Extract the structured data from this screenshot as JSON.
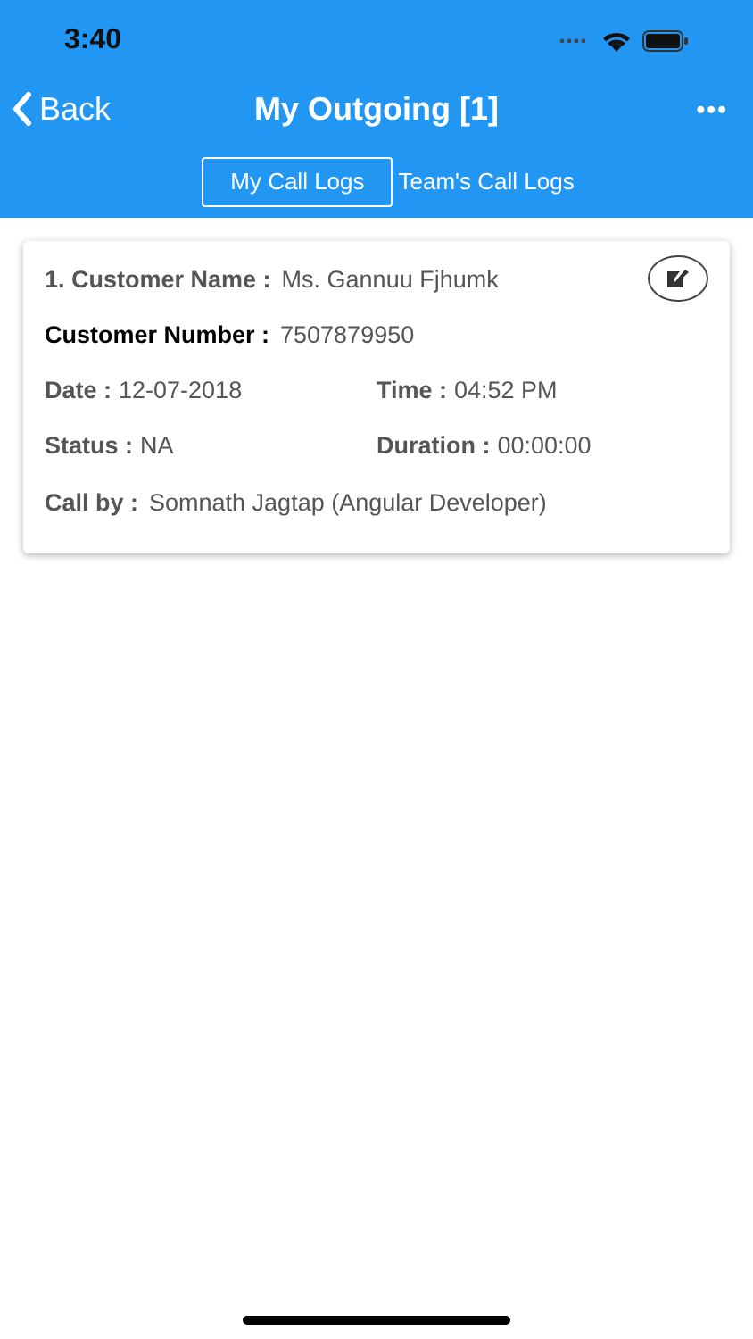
{
  "status_bar": {
    "time": "3:40"
  },
  "nav": {
    "back": "Back",
    "title": "My Outgoing [1]",
    "more": "•••"
  },
  "tabs": [
    {
      "label": "My Call Logs",
      "selected": true
    },
    {
      "label": "Team's Call Logs",
      "selected": false
    }
  ],
  "call_logs": [
    {
      "rows": [
        [
          {
            "label": "1. Customer Name :",
            "value": "Ms. Gannuu Fjhumk",
            "strong": false
          }
        ],
        [
          {
            "label": "Customer Number :",
            "value": "7507879950",
            "strong": true
          }
        ],
        [
          {
            "label": "Date :",
            "value": "12-07-2018",
            "strong": false
          },
          {
            "label": "Time :",
            "value": "04:52 PM",
            "strong": false
          }
        ],
        [
          {
            "label": "Status :",
            "value": "NA",
            "strong": false
          },
          {
            "label": "Duration :",
            "value": "00:00:00",
            "strong": false
          }
        ],
        [
          {
            "label": "Call by :",
            "value": "Somnath Jagtap (Angular Developer)",
            "strong": false
          }
        ]
      ]
    }
  ]
}
